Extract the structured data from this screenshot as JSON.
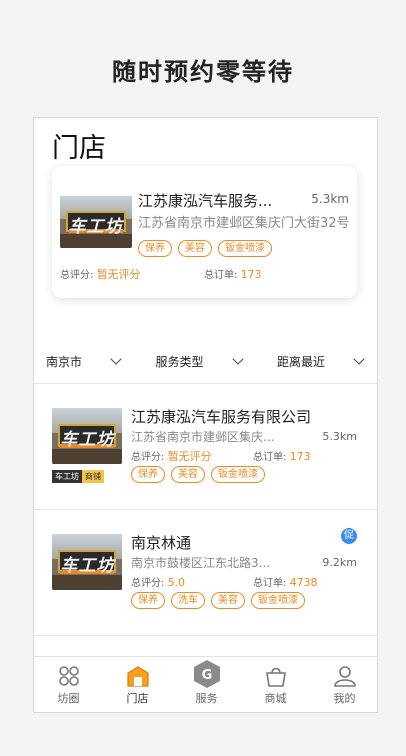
{
  "headline": "随时预约零等待",
  "page_title": "门店",
  "featured": {
    "name": "江苏康泓汽车服务...",
    "distance": "5.3km",
    "address": "江苏省南京市建邺区集庆门大街32号",
    "tags": [
      "保养",
      "美容",
      "钣金喷漆"
    ],
    "rating_label": "总评分:",
    "rating_value": "暂无评分",
    "orders_label": "总订单:",
    "orders_value": "173",
    "thumb_text": "车工坊"
  },
  "filters": [
    {
      "label": "南京市",
      "icon": "chevron-down-icon"
    },
    {
      "label": "服务类型",
      "icon": "chevron-down-icon"
    },
    {
      "label": "距离最近",
      "icon": "chevron-down-icon"
    }
  ],
  "stores": [
    {
      "name": "江苏康泓汽车服务有限公司",
      "address": "江苏省南京市建邺区集庆...",
      "distance": "5.3km",
      "rating_label": "总评分:",
      "rating_value": "暂无评分",
      "orders_label": "总订单:",
      "orders_value": "173",
      "tags": [
        "保养",
        "美容",
        "钣金喷漆"
      ],
      "badge": [
        "车工坊",
        "商铺"
      ],
      "thumb_text": "车工坊"
    },
    {
      "name": "南京林通",
      "address": "南京市鼓楼区江东北路3...",
      "distance": "9.2km",
      "rating_label": "总评分:",
      "rating_value": "5.0",
      "orders_label": "总订单:",
      "orders_value": "4738",
      "tags": [
        "保养",
        "洗车",
        "美容",
        "钣金喷漆"
      ],
      "promo": "促",
      "thumb_text": "车工坊"
    }
  ],
  "tabbar": [
    {
      "label": "坊圈",
      "icon": "community-icon"
    },
    {
      "label": "门店",
      "icon": "store-icon"
    },
    {
      "label": "服务",
      "icon": "service-icon"
    },
    {
      "label": "商城",
      "icon": "shop-bag-icon"
    },
    {
      "label": "我的",
      "icon": "profile-icon"
    }
  ],
  "colors": {
    "accent": "#f08a24",
    "promo": "#3d8de8"
  }
}
